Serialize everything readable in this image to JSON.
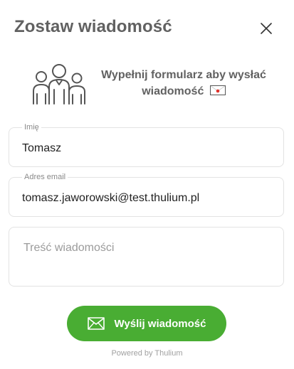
{
  "header": {
    "title": "Zostaw wiadomość",
    "close_icon": "close-icon"
  },
  "intro": {
    "icon": "people-group-icon",
    "text": "Wypełnij formularz aby wysłać wiadomość",
    "emoji": "envelope-emoji"
  },
  "form": {
    "name": {
      "label": "Imię",
      "value": "Tomasz"
    },
    "email": {
      "label": "Adres email",
      "value": "tomasz.jaworowski@test.thulium.pl"
    },
    "message": {
      "placeholder": "Treść wiadomości",
      "value": ""
    }
  },
  "submit": {
    "label": "Wyślij wiadomość",
    "icon": "envelope-icon",
    "color": "#49ad33"
  },
  "footer": {
    "powered_by": "Powered by Thulium"
  }
}
